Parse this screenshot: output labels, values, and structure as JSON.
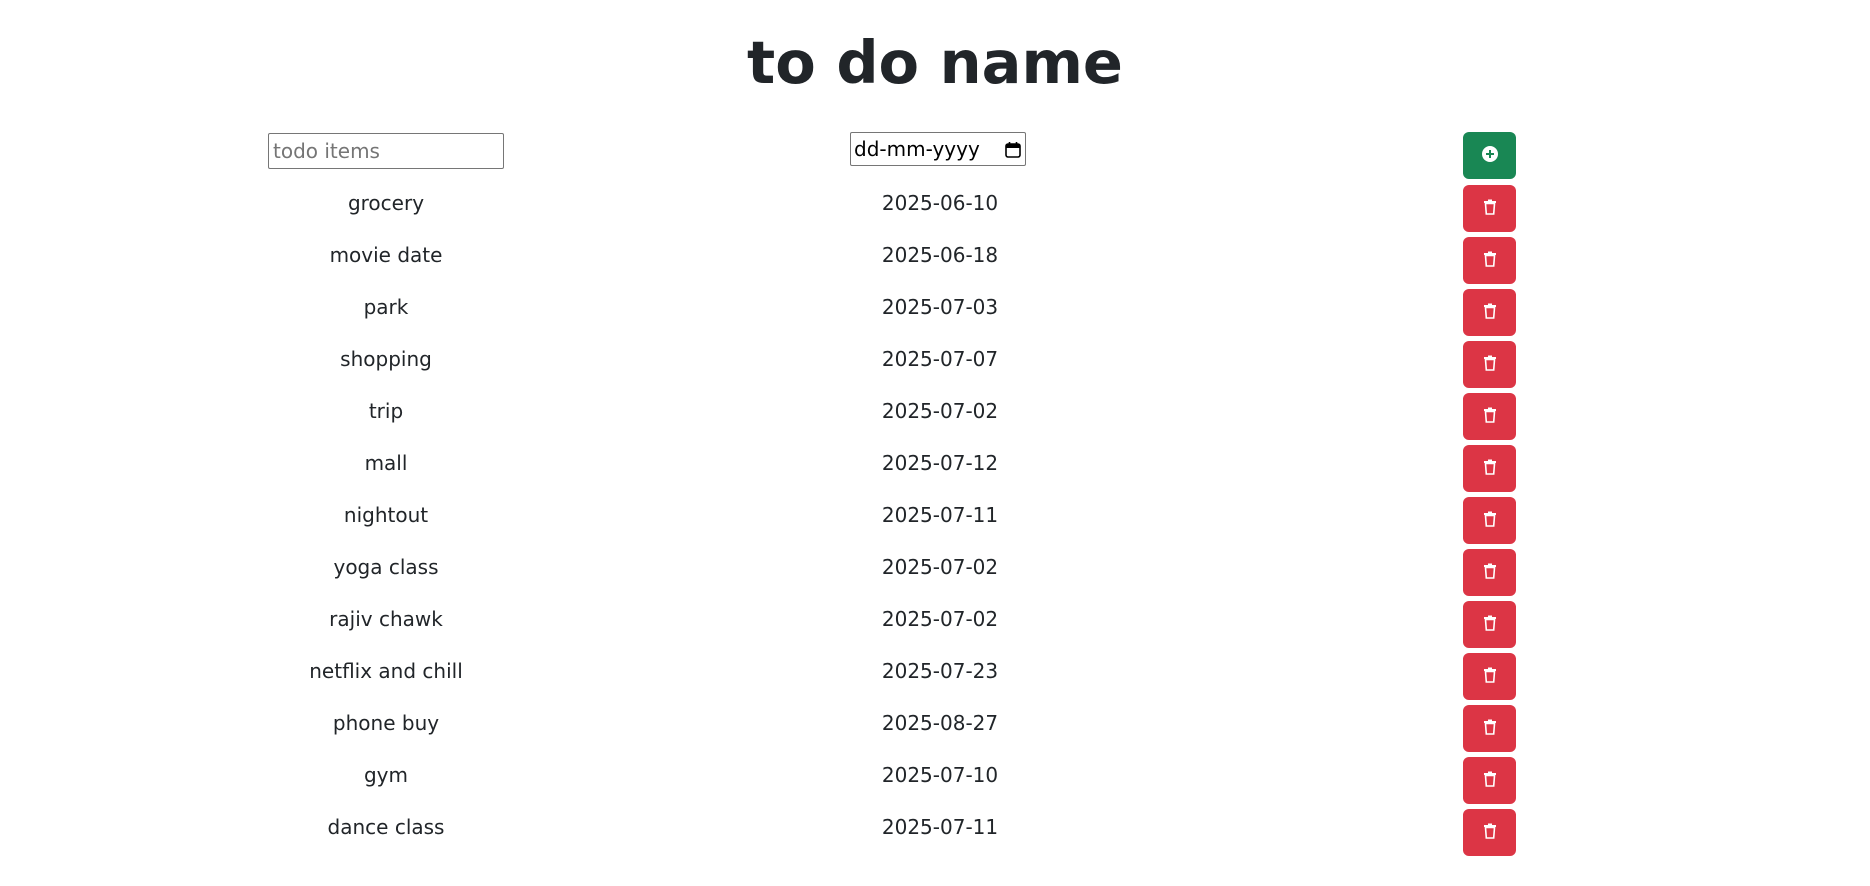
{
  "title": "to do name",
  "input": {
    "placeholder": "todo items",
    "date_placeholder": "dd-mm-yyyy"
  },
  "colors": {
    "add_button": "#198754",
    "delete_button": "#dc3545",
    "text": "#212529"
  },
  "icons": {
    "add": "plus-circle-icon",
    "delete": "trash-icon",
    "calendar": "calendar-icon"
  },
  "todos": [
    {
      "name": "grocery",
      "date": "2025-06-10"
    },
    {
      "name": "movie date",
      "date": "2025-06-18"
    },
    {
      "name": "park",
      "date": "2025-07-03"
    },
    {
      "name": "shopping",
      "date": "2025-07-07"
    },
    {
      "name": "trip",
      "date": "2025-07-02"
    },
    {
      "name": "mall",
      "date": "2025-07-12"
    },
    {
      "name": "nightout",
      "date": "2025-07-11"
    },
    {
      "name": "yoga class",
      "date": "2025-07-02"
    },
    {
      "name": "rajiv chawk",
      "date": "2025-07-02"
    },
    {
      "name": "netflix and chill",
      "date": "2025-07-23"
    },
    {
      "name": "phone buy",
      "date": "2025-08-27"
    },
    {
      "name": "gym",
      "date": "2025-07-10"
    },
    {
      "name": "dance class",
      "date": "2025-07-11"
    }
  ]
}
